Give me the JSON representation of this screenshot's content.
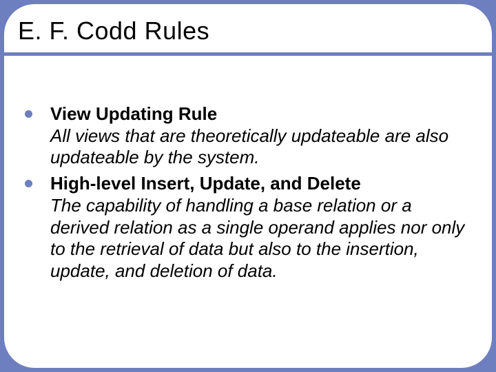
{
  "slide": {
    "title": "E. F. Codd Rules",
    "bullets": [
      {
        "heading": "View Updating Rule",
        "description": "All views that are theoretically updateable are also updateable by the system."
      },
      {
        "heading": "High-level Insert, Update, and Delete",
        "description": "The capability of handling a base relation or a derived relation as a single operand applies nor only to the retrieval of data but also to the insertion, update, and deletion of data."
      }
    ]
  }
}
